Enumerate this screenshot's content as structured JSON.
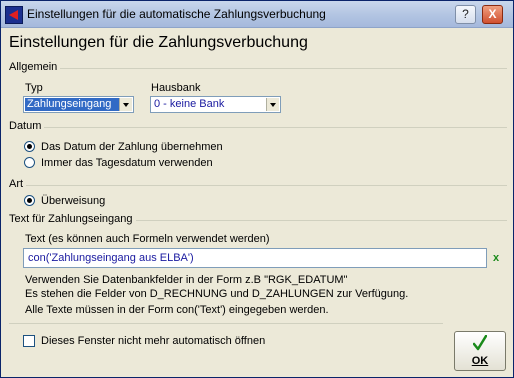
{
  "window": {
    "title": "Einstellungen für die automatische Zahlungsverbuchung",
    "help_label": "?",
    "close_label": "X"
  },
  "heading": "Einstellungen für die Zahlungsverbuchung",
  "allgemein": {
    "label": "Allgemein",
    "typ_label": "Typ",
    "typ_value": "Zahlungseingang",
    "hausbank_label": "Hausbank",
    "hausbank_value": "0 - keine Bank"
  },
  "datum": {
    "label": "Datum",
    "options": [
      {
        "label": "Das Datum der Zahlung übernehmen",
        "selected": true
      },
      {
        "label": "Immer das Tagesdatum verwenden",
        "selected": false
      }
    ]
  },
  "art": {
    "label": "Art",
    "options": [
      {
        "label": "Überweisung",
        "selected": true
      }
    ]
  },
  "text": {
    "label": "Text für Zahlungseingang",
    "field_label": "Text (es können auch Formeln verwendet werden)",
    "field_value": "con('Zahlungseingang aus ELBA')",
    "clear_label": "x",
    "hint1": "Verwenden Sie Datenbankfelder in der Form z.B \"RGK_EDATUM\"",
    "hint2": "Es stehen die Felder von D_RECHNUNG und D_ZAHLUNGEN zur Verfügung.",
    "hint3": "Alle Texte müssen in der Form con('Text') eingegeben werden."
  },
  "footer": {
    "checkbox_label": "Dieses Fenster nicht mehr automatisch öffnen",
    "checkbox_checked": false,
    "ok_label": "OK"
  },
  "colors": {
    "selection": "#316ac5",
    "check_icon": "#1a8a1a",
    "link_text": "#1a1aa0"
  }
}
